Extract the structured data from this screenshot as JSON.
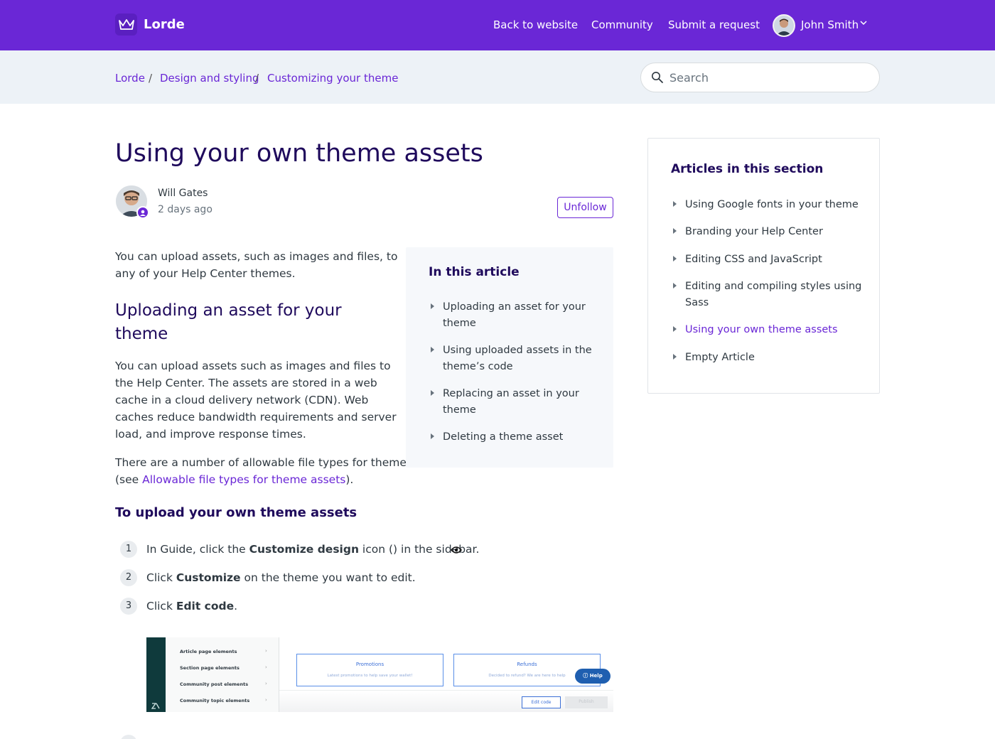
{
  "header": {
    "brand": "Lorde",
    "nav": {
      "back": "Back to website",
      "community": "Community",
      "submit": "Submit a request"
    },
    "user_name": "John Smith"
  },
  "breadcrumbs": [
    "Lorde",
    "Design and styling",
    "Customizing your theme"
  ],
  "search": {
    "placeholder": "Search"
  },
  "article": {
    "title": "Using your own theme assets",
    "author": "Will Gates",
    "date": "2 days ago",
    "unfollow_label": "Unfollow",
    "intro_line1": "You can upload assets, such as images and files, to",
    "intro_line2": "any of your Help Center themes.",
    "h2_upload": "Uploading an asset for your theme",
    "p1": [
      "You can upload assets such as images and files to",
      "the Help Center. The assets are stored in a web",
      "cache in a cloud delivery network (CDN). Web",
      "caches reduce bandwidth requirements and server",
      "load, and improve response times."
    ],
    "p2_line1": "There are a number of allowable file types for themes",
    "p2_pre": "(see ",
    "p2_link": "Allowable file types for theme assets",
    "p2_post": ").",
    "h3_upload": "To upload your own theme assets",
    "steps": [
      {
        "num": "1",
        "pre": "In Guide, click the ",
        "bold": "Customize design",
        "post": " icon () in the sidebar."
      },
      {
        "num": "2",
        "pre": "Click ",
        "bold": "Customize",
        "post": " on the theme you want to edit."
      },
      {
        "num": "3",
        "pre": "Click ",
        "bold": "Edit code",
        "post": "."
      }
    ]
  },
  "toc": {
    "title": "In this article",
    "items": [
      [
        "Uploading an asset for your",
        "theme"
      ],
      [
        "Using uploaded assets in the",
        "theme’s code"
      ],
      [
        "Replacing an asset in your",
        "theme"
      ],
      [
        "Deleting a theme asset"
      ]
    ]
  },
  "screenshot": {
    "menu_items": [
      "Article page elements",
      "Section page elements",
      "Community post elements",
      "Community topic elements"
    ],
    "cards": [
      {
        "title": "Promotions",
        "sub": "Latest promotions to help save your wallet!"
      },
      {
        "title": "Refunds",
        "sub": "Decided to refund? We are here to help"
      }
    ],
    "help_label": "Help",
    "edit_code_label": "Edit code",
    "publish_label": "Publish"
  },
  "sidebar": {
    "title": "Articles in this section",
    "items": [
      [
        "Using Google fonts in your theme"
      ],
      [
        "Branding your Help Center"
      ],
      [
        "Editing CSS and JavaScript"
      ],
      [
        "Editing and compiling styles using",
        "Sass"
      ],
      [
        "Using your own theme assets"
      ],
      [
        "Empty Article"
      ]
    ],
    "active_index": 4
  },
  "colors": {
    "brand": "#6a27d6",
    "heading": "#1f0a5c",
    "subbar": "#edf2f7"
  }
}
